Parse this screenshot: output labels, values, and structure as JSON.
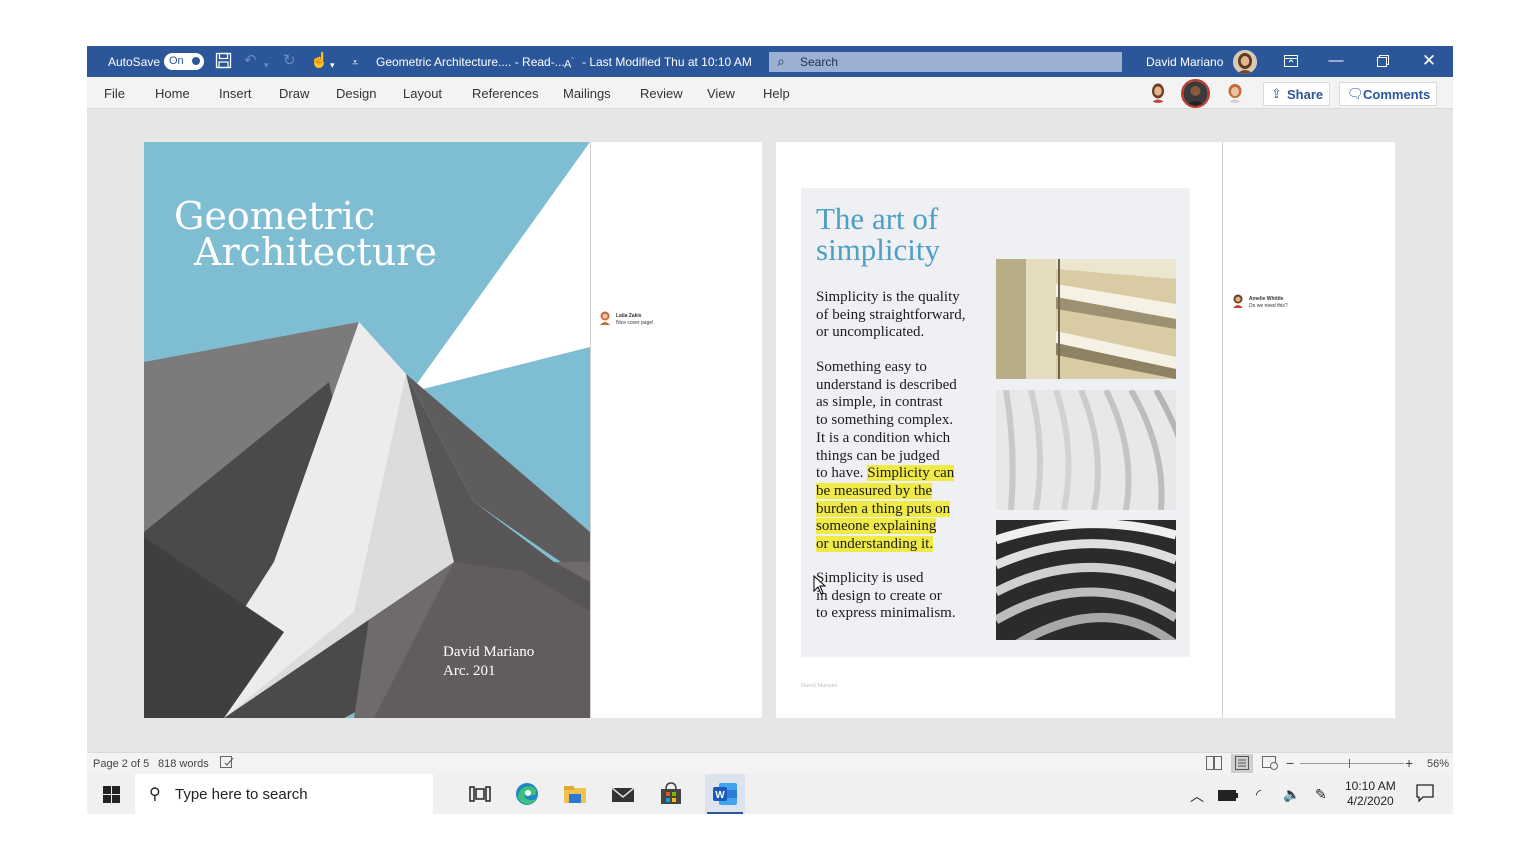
{
  "titlebar": {
    "autosave_label": "AutoSave",
    "autosave_state": "On",
    "document_title": "Geometric Architecture.... - Read-...",
    "last_modified": "- Last Modified Thu at 10:10 AM",
    "search_placeholder": "Search",
    "user_name": "David Mariano",
    "accent_color": "#2b579a"
  },
  "menu": {
    "items": [
      "File",
      "Home",
      "Insert",
      "Draw",
      "Design",
      "Layout",
      "References",
      "Mailings",
      "Review",
      "View",
      "Help"
    ],
    "share_label": "Share",
    "comments_label": "Comments"
  },
  "cover": {
    "title_line1": "Geometric",
    "title_line2": "Architecture",
    "author": "David Mariano",
    "course": "Arc. 201",
    "sky_color": "#7fbdd3"
  },
  "comments": [
    {
      "author": "Laila Zakis",
      "text": "Nice cover page!"
    },
    {
      "author": "Amelie Whittle",
      "text": "Do we need this?"
    }
  ],
  "article": {
    "heading_line1": "The art of",
    "heading_line2": "simplicity",
    "para1": "Simplicity is the quality\nof being straightforward,\nor uncomplicated.",
    "para2_plain": "Something easy to\nunderstand is described\nas simple, in contrast\nto something complex.\nIt is a condition which\nthings can be judged\nto have. ",
    "para2_highlight_lines": [
      "Simplicity can",
      "be measured by the",
      "burden a thing puts on",
      "someone explaining",
      "or understanding it."
    ],
    "para3": "Simplicity is used\nin design to create or\nto express minimalism.",
    "footer": "David Mariano",
    "heading_color": "#4d9fc4",
    "highlight_color": "#f0ea47"
  },
  "status": {
    "page": "Page 2 of 5",
    "words": "818 words",
    "zoom": "56%"
  },
  "taskbar": {
    "search_placeholder": "Type here to search",
    "time": "10:10 AM",
    "date": "4/2/2020"
  }
}
